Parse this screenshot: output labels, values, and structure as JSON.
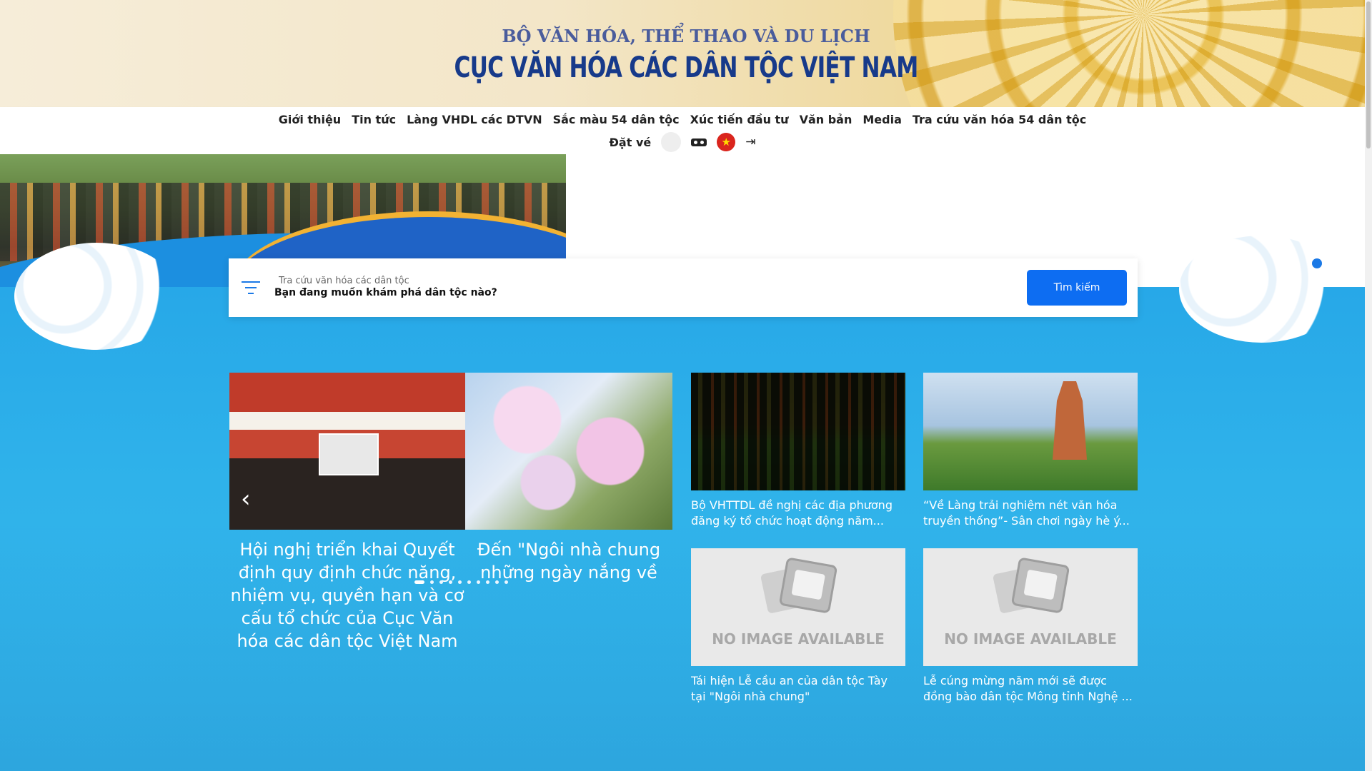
{
  "header": {
    "ministry": "BỘ VĂN HÓA, THỂ THAO VÀ DU LỊCH",
    "department": "CỤC VĂN HÓA CÁC DÂN TỘC VIỆT NAM"
  },
  "nav": {
    "items": [
      {
        "label": "Giới thiệu"
      },
      {
        "label": "Tin tức"
      },
      {
        "label": "Làng VHDL các DTVN"
      },
      {
        "label": "Sắc màu 54 dân tộc"
      },
      {
        "label": "Xúc tiến đầu tư"
      },
      {
        "label": "Văn bản"
      },
      {
        "label": "Media"
      },
      {
        "label": "Tra cứu văn hóa 54 dân tộc"
      }
    ],
    "book_ticket": "Đặt vé",
    "icons": [
      "vr-headset-icon",
      "vietnam-flag-icon",
      "login-icon"
    ]
  },
  "search": {
    "label": "Tra cứu văn hóa các dân tộc",
    "placeholder": "Bạn đang muốn khám phá dân tộc nào?",
    "button": "Tìm kiếm"
  },
  "carousel": {
    "slides": [
      {
        "title": "Hội nghị triển khai Quyết định quy định chức năng, nhiệm vụ, quyền hạn và cơ cấu tổ chức của Cục Văn hóa các dân tộc Việt Nam"
      },
      {
        "title": "Đến \"Ngôi nhà chung những ngày nắng về"
      }
    ],
    "dot_count": 10,
    "active_dot": 0
  },
  "news": [
    {
      "title": "Bộ VHTTDL đề nghị các địa phương đăng ký tổ chức hoạt động năm...",
      "image": "photo"
    },
    {
      "title": "“Về Làng trải nghiệm nét văn hóa truyền thống”- Sân chơi ngày hè ý...",
      "image": "photo"
    },
    {
      "title": "Tái hiện Lễ cầu an của dân tộc Tày tại \"Ngôi nhà chung\"",
      "image": "no-image"
    },
    {
      "title": "Lễ cúng mừng năm mới sẽ được đồng bào dân tộc Mông tỉnh Nghệ ...",
      "image": "no-image"
    }
  ],
  "no_image_text": "NO IMAGE AVAILABLE",
  "colors": {
    "primary_blue": "#0d6df2",
    "title_navy": "#173a8a",
    "hero_blue": "#2fb2ea"
  }
}
